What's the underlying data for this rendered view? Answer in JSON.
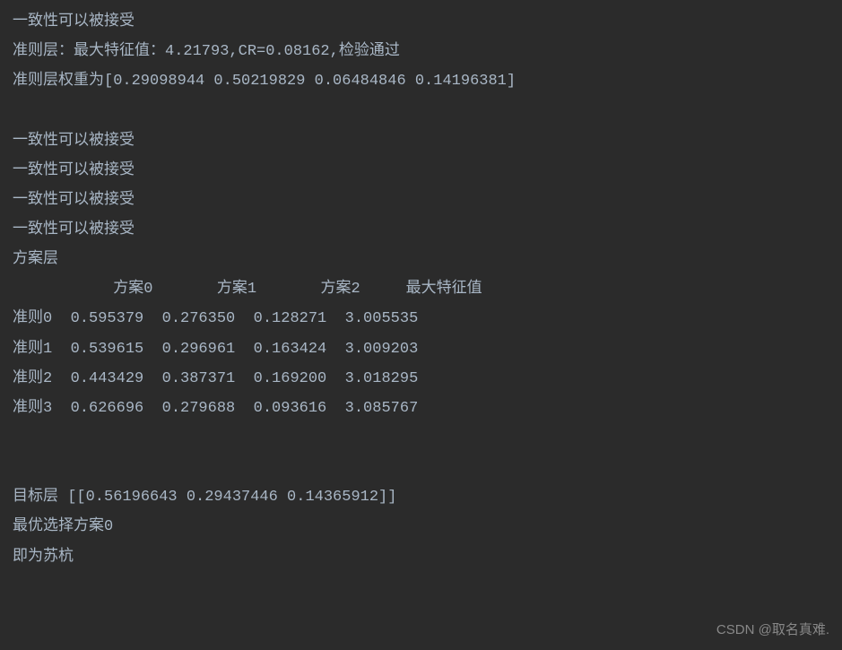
{
  "lines": {
    "l1": "一致性可以被接受",
    "l2": "准则层：最大特征值：4.21793,CR=0.08162,检验通过",
    "l3": "准则层权重为[0.29098944 0.50219829 0.06484846 0.14196381]",
    "l4": "一致性可以被接受",
    "l5": "一致性可以被接受",
    "l6": "一致性可以被接受",
    "l7": "一致性可以被接受",
    "l8": "方案层",
    "l9": "           方案0       方案1       方案2     最大特征值",
    "l10": "准则0  0.595379  0.276350  0.128271  3.005535",
    "l11": "准则1  0.539615  0.296961  0.163424  3.009203",
    "l12": "准则2  0.443429  0.387371  0.169200  3.018295",
    "l13": "准则3  0.626696  0.279688  0.093616  3.085767",
    "l14": "目标层 [[0.56196643 0.29437446 0.14365912]]",
    "l15": "最优选择方案0",
    "l16": "即为苏杭"
  },
  "watermark": "CSDN @取名真难.",
  "chart_data": {
    "type": "table",
    "criteria_layer": {
      "max_eigenvalue": 4.21793,
      "CR": 0.08162,
      "status": "检验通过",
      "weights": [
        0.29098944,
        0.50219829,
        0.06484846,
        0.14196381
      ]
    },
    "scheme_layer": {
      "columns": [
        "方案0",
        "方案1",
        "方案2",
        "最大特征值"
      ],
      "rows": [
        {
          "label": "准则0",
          "values": [
            0.595379,
            0.27635,
            0.128271,
            3.005535
          ]
        },
        {
          "label": "准则1",
          "values": [
            0.539615,
            0.296961,
            0.163424,
            3.009203
          ]
        },
        {
          "label": "准则2",
          "values": [
            0.443429,
            0.387371,
            0.1692,
            3.018295
          ]
        },
        {
          "label": "准则3",
          "values": [
            0.626696,
            0.279688,
            0.093616,
            3.085767
          ]
        }
      ]
    },
    "target_layer": [
      0.56196643,
      0.29437446,
      0.14365912
    ],
    "best_choice": "方案0",
    "best_choice_name": "苏杭"
  }
}
